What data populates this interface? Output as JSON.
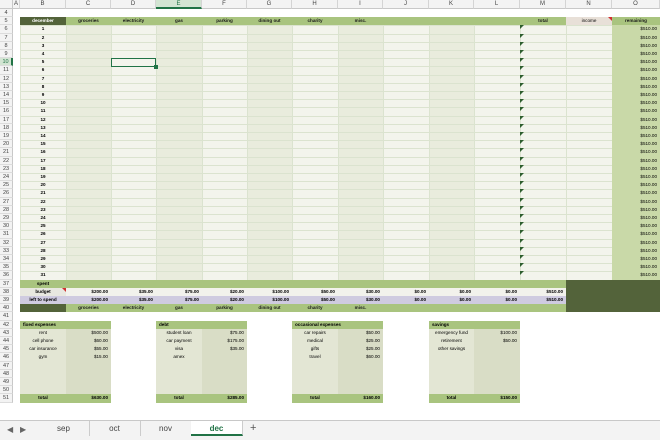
{
  "columns": [
    "A",
    "B",
    "C",
    "D",
    "E",
    "F",
    "G",
    "H",
    "I",
    "J",
    "K",
    "L",
    "M",
    "N",
    "O"
  ],
  "selected_column": "E",
  "selected_row": 10,
  "rows": [
    4,
    5,
    6,
    7,
    8,
    9,
    10,
    11,
    12,
    13,
    14,
    15,
    16,
    17,
    18,
    19,
    20,
    21,
    22,
    23,
    24,
    25,
    26,
    27,
    28,
    29,
    30,
    31,
    32,
    33,
    34,
    35,
    36,
    37,
    38,
    39,
    40,
    41,
    42,
    43,
    44,
    45,
    46,
    47,
    48,
    49,
    50,
    51
  ],
  "header_row": {
    "month": "december",
    "categories": [
      "groceries",
      "electricity",
      "gas",
      "parking",
      "dining out",
      "charity",
      "misc."
    ],
    "total": "total",
    "income": "income",
    "remaining": "remaining"
  },
  "days": [
    "1",
    "2",
    "3",
    "4",
    "5",
    "6",
    "7",
    "8",
    "9",
    "10",
    "11",
    "12",
    "13",
    "14",
    "15",
    "16",
    "17",
    "18",
    "19",
    "20",
    "21",
    "22",
    "23",
    "24",
    "25",
    "26",
    "27",
    "28",
    "29",
    "30",
    "31"
  ],
  "remaining_value": "$510.00",
  "spent_label": "spent",
  "budget": {
    "label": "budget",
    "values": [
      "$200.00",
      "$35.00",
      "$75.00",
      "$20.00",
      "$100.00",
      "$50.00",
      "$30.00",
      "$0.00",
      "$0.00",
      "$0.00"
    ],
    "total": "$510.00"
  },
  "left_to_spend": {
    "label": "left to spend",
    "values": [
      "$200.00",
      "$35.00",
      "$75.00",
      "$20.00",
      "$100.00",
      "$50.00",
      "$30.00",
      "$0.00",
      "$0.00",
      "$0.00"
    ],
    "total": "$510.00"
  },
  "footer_categories": [
    "groceries",
    "electricity",
    "gas",
    "parking",
    "dining out",
    "charity",
    "misc."
  ],
  "panels": [
    {
      "title": "fixed expenses",
      "items": [
        {
          "name": "rent",
          "value": "$500.00"
        },
        {
          "name": "cell phone",
          "value": "$60.00"
        },
        {
          "name": "car insurance",
          "value": "$55.00"
        },
        {
          "name": "gym",
          "value": "$15.00"
        }
      ],
      "total_label": "total",
      "total": "$630.00"
    },
    {
      "title": "debt",
      "items": [
        {
          "name": "student loan",
          "value": "$75.00"
        },
        {
          "name": "car payment",
          "value": "$175.00"
        },
        {
          "name": "visa",
          "value": "$35.00"
        },
        {
          "name": "amex",
          "value": ""
        }
      ],
      "total_label": "total",
      "total": "$285.00"
    },
    {
      "title": "occasional expenses",
      "items": [
        {
          "name": "car repairs",
          "value": "$50.00"
        },
        {
          "name": "medical",
          "value": "$25.00"
        },
        {
          "name": "gifts",
          "value": "$25.00"
        },
        {
          "name": "travel",
          "value": "$60.00"
        }
      ],
      "total_label": "total",
      "total": "$160.00"
    },
    {
      "title": "savings",
      "items": [
        {
          "name": "emergency fund",
          "value": "$100.00"
        },
        {
          "name": "retirement",
          "value": "$50.00"
        },
        {
          "name": "other savings",
          "value": ""
        },
        {
          "name": "",
          "value": ""
        }
      ],
      "total_label": "total",
      "total": "$150.00"
    }
  ],
  "tabs": [
    {
      "label": "sep"
    },
    {
      "label": "oct"
    },
    {
      "label": "nov"
    },
    {
      "label": "dec"
    }
  ],
  "active_tab": "dec",
  "colors": {
    "header_green": "#a9c47f",
    "panel_bg": "#eef0e6",
    "dark_green": "#53633a",
    "budget_row": "#cfcbe0",
    "accent": "#217346"
  }
}
